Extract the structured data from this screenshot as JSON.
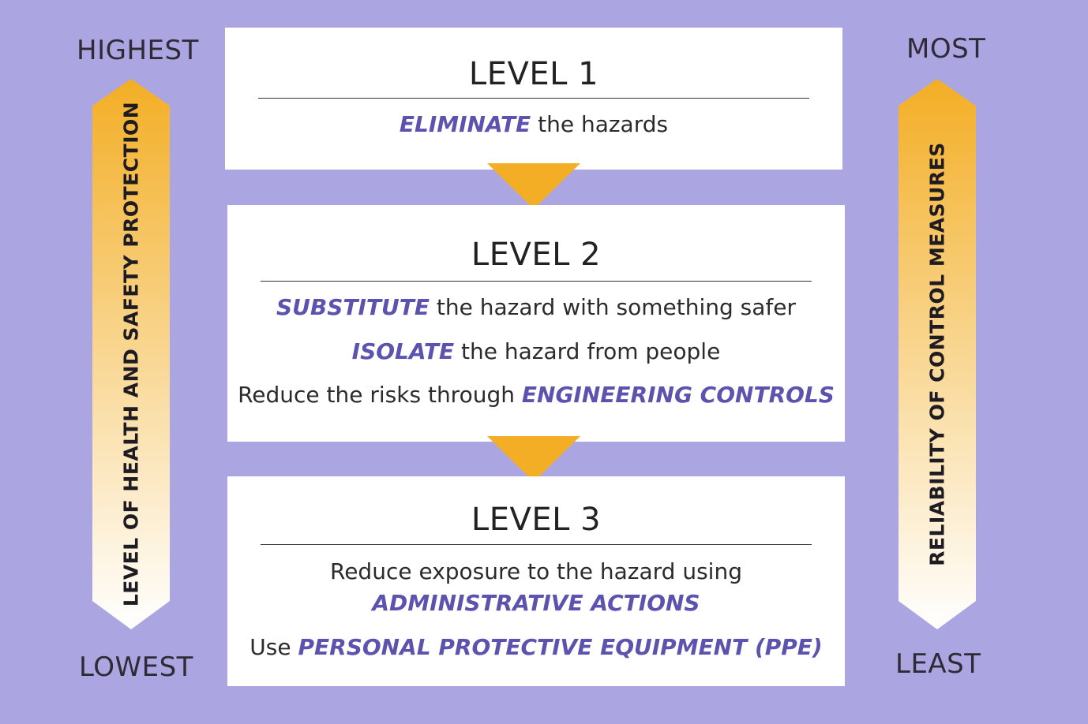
{
  "colors": {
    "background": "#aba6e2",
    "box": "#ffffff",
    "arrow_top": "#f3ae25",
    "arrow_bottom": "#ffffff",
    "emphasis": "#5c53b0"
  },
  "left_scale": {
    "top_label": "HIGHEST",
    "bottom_label": "LOWEST",
    "arrow_text": "LEVEL OF HEALTH AND SAFETY PROTECTION"
  },
  "right_scale": {
    "top_label": "MOST",
    "bottom_label": "LEAST",
    "arrow_text": "RELIABILITY OF CONTROL MEASURES"
  },
  "levels": [
    {
      "title": "LEVEL 1",
      "lines": [
        {
          "em": "ELIMINATE",
          "after": " the hazards"
        }
      ]
    },
    {
      "title": "LEVEL 2",
      "lines": [
        {
          "em": "SUBSTITUTE",
          "after": " the hazard with something safer"
        },
        {
          "em": "ISOLATE",
          "after": " the hazard from people"
        },
        {
          "before": "Reduce the risks through ",
          "em": "ENGINEERING CONTROLS"
        }
      ]
    },
    {
      "title": "LEVEL 3",
      "lines": [
        {
          "before": "Reduce exposure to the hazard using"
        },
        {
          "em": "ADMINISTRATIVE ACTIONS"
        },
        {
          "before": "Use ",
          "em": "PERSONAL PROTECTIVE EQUIPMENT (PPE)"
        }
      ]
    }
  ]
}
